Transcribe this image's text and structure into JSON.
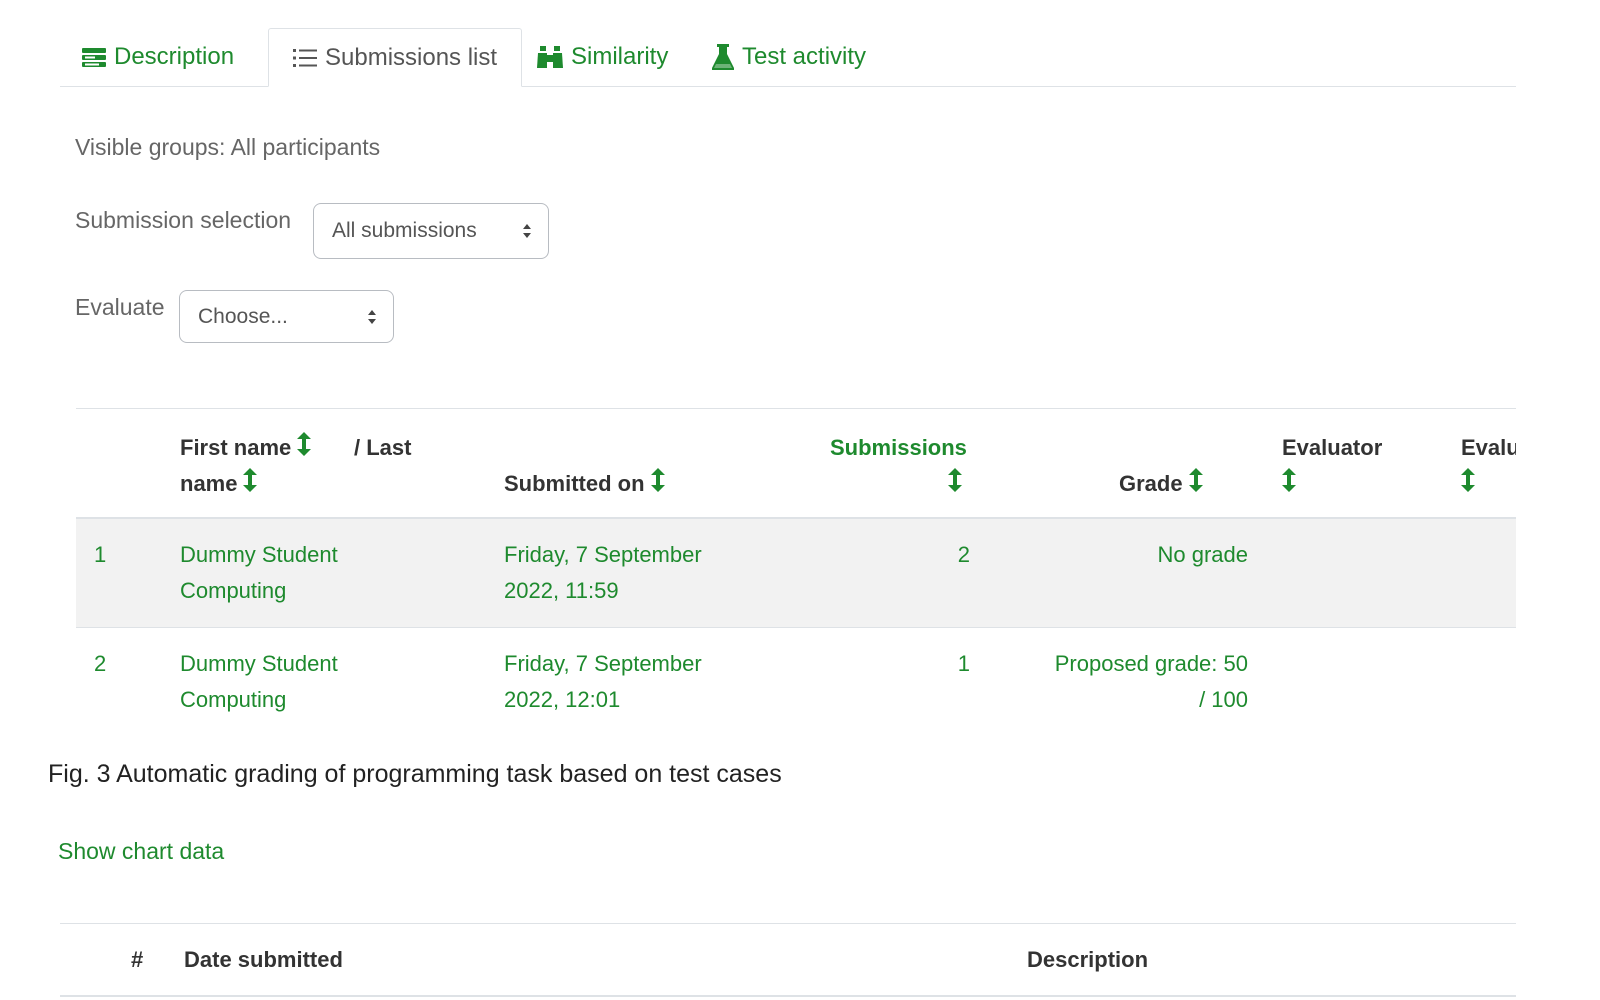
{
  "tabs": [
    {
      "label": "Description",
      "icon": "description-icon",
      "active": false
    },
    {
      "label": "Submissions list",
      "icon": "list-icon",
      "active": true
    },
    {
      "label": "Similarity",
      "icon": "binoculars-icon",
      "active": false
    },
    {
      "label": "Test activity",
      "icon": "flask-icon",
      "active": false
    }
  ],
  "groups_text": "Visible groups: All participants",
  "submission_selection": {
    "label": "Submission selection",
    "value": "All submissions"
  },
  "evaluate": {
    "label": "Evaluate",
    "value": "Choose..."
  },
  "table": {
    "headers": {
      "first_name": "First name",
      "last_name": "/ Last",
      "last_name_2": "name",
      "submitted_on": "Submitted on",
      "submissions": "Submissions",
      "grade": "Grade",
      "evaluator": "Evaluator",
      "evaluated": "Evalu"
    },
    "rows": [
      {
        "num": "1",
        "name_1": "Dummy Student",
        "name_2": "Computing",
        "date_1": "Friday, 7 September",
        "date_2": "2022, 11:59",
        "submissions": "2",
        "grade_1": "No grade",
        "grade_2": ""
      },
      {
        "num": "2",
        "name_1": "Dummy Student",
        "name_2": "Computing",
        "date_1": "Friday, 7 September",
        "date_2": "2022, 12:01",
        "submissions": "1",
        "grade_1": "Proposed grade: 50",
        "grade_2": "/ 100"
      }
    ]
  },
  "caption": "Fig. 3 Automatic grading of programming task based on test cases",
  "chart_link": "Show chart data",
  "table2": {
    "headers": {
      "num": "#",
      "date": "Date submitted",
      "description": "Description"
    }
  },
  "colors": {
    "accent": "#1e8a2e",
    "shaded_row": "#f2f2f2",
    "border": "#dee2e6"
  }
}
